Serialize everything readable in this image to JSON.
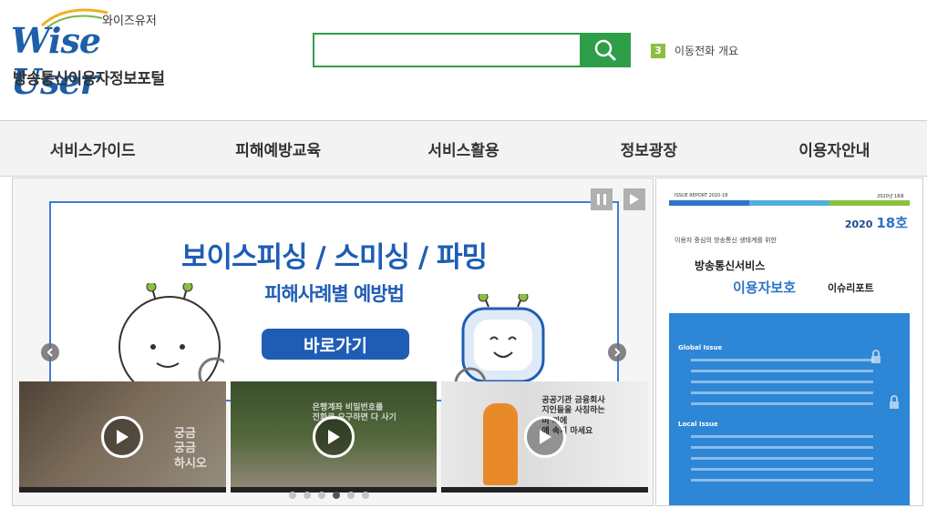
{
  "header": {
    "logo_kor": "와이즈유저",
    "logo_eng": "Wise User",
    "logo_sub": "방송통신이용자정보포털",
    "search": {
      "value": "",
      "placeholder": ""
    },
    "ticker": {
      "number": "3",
      "text": "이동전화 개요"
    }
  },
  "nav": {
    "items": [
      {
        "label": "서비스가이드"
      },
      {
        "label": "피해예방교육"
      },
      {
        "label": "서비스활용"
      },
      {
        "label": "정보광장"
      },
      {
        "label": "이용자안내"
      }
    ]
  },
  "banner": {
    "title": "보이스피싱 / 스미싱 / 파밍",
    "subtitle": "피해사례별 예방법",
    "cta": "바로가기",
    "slide_count": 6,
    "active_slide": 4
  },
  "videos": [
    {
      "overlay_text": "궁금\n궁금\n하시오"
    },
    {
      "overlay_text": "은행계좌 비밀번호를\n전화로 요구하면 다 사기"
    },
    {
      "overlay_text": "공공기관 금융회사\n지인들을 사칭하는\n미 끼에\n에 속지 마세요"
    }
  ],
  "report": {
    "header_left": "ISSUE REPORT 2020-18",
    "header_right": "2020년 18호",
    "issue_year": "2020",
    "issue_no": "18호",
    "tagline": "이용자 중심의 방송통신 생태계를 위한",
    "title1": "방송통신서비스",
    "title2": "이용자보호",
    "title3": "이슈리포트",
    "section1": "Global Issue",
    "section2": "Local Issue"
  },
  "colors": {
    "brand_green": "#2e9e48",
    "brand_blue": "#1f5db5",
    "ticker_green": "#8dbf3f",
    "report_blue": "#2d86d6"
  }
}
